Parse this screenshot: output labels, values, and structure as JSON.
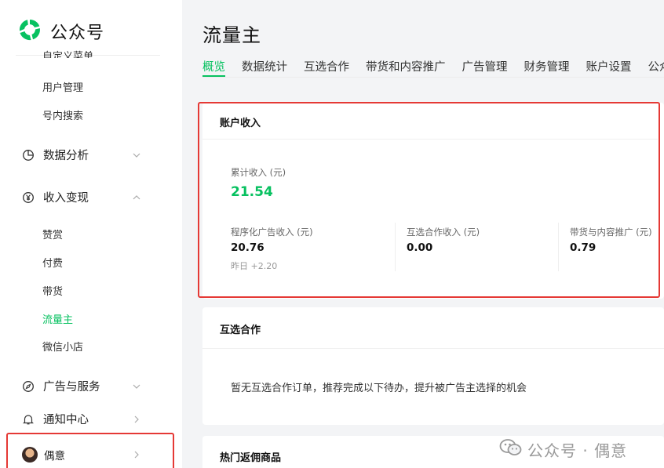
{
  "brand": {
    "name": "公众号",
    "green": "#07c160",
    "highlight_red": "#e53935"
  },
  "sidebar": {
    "cut_item": "自定义菜单",
    "items_top": [
      "用户管理",
      "号内搜索"
    ],
    "data_analysis": {
      "label": "数据分析",
      "icon": "pie-chart-icon",
      "expanded": false
    },
    "income": {
      "label": "收入变现",
      "icon": "yen-circle-icon",
      "expanded": true
    },
    "income_children": [
      "赞赏",
      "付费",
      "带货",
      "流量主",
      "微信小店"
    ],
    "active_child": "流量主",
    "ads": {
      "label": "广告与服务",
      "icon": "compass-icon",
      "expanded": false
    },
    "notify": {
      "label": "通知中心",
      "icon": "bell-icon"
    },
    "user": {
      "name": "偶意"
    }
  },
  "main": {
    "title": "流量主",
    "tabs": [
      "概览",
      "数据统计",
      "互选合作",
      "带货和内容推广",
      "广告管理",
      "财务管理",
      "账户设置",
      "公众"
    ],
    "active_tab": "概览",
    "account_income": {
      "title": "账户收入",
      "total_label": "累计收入 (元)",
      "total_value": "21.54",
      "metrics": [
        {
          "label": "程序化广告收入 (元)",
          "value": "20.76",
          "note": "昨日 +2.20"
        },
        {
          "label": "互选合作收入 (元)",
          "value": "0.00"
        },
        {
          "label": "带货与内容推广 (元)",
          "value": "0.79"
        }
      ]
    },
    "mutual": {
      "title": "互选合作",
      "empty_text": "暂无互选合作订单，推荐完成以下待办，提升被广告主选择的机会"
    },
    "hot_products": {
      "title": "热门返佣商品"
    }
  },
  "watermark": {
    "text": "公众号 · 偶意"
  }
}
